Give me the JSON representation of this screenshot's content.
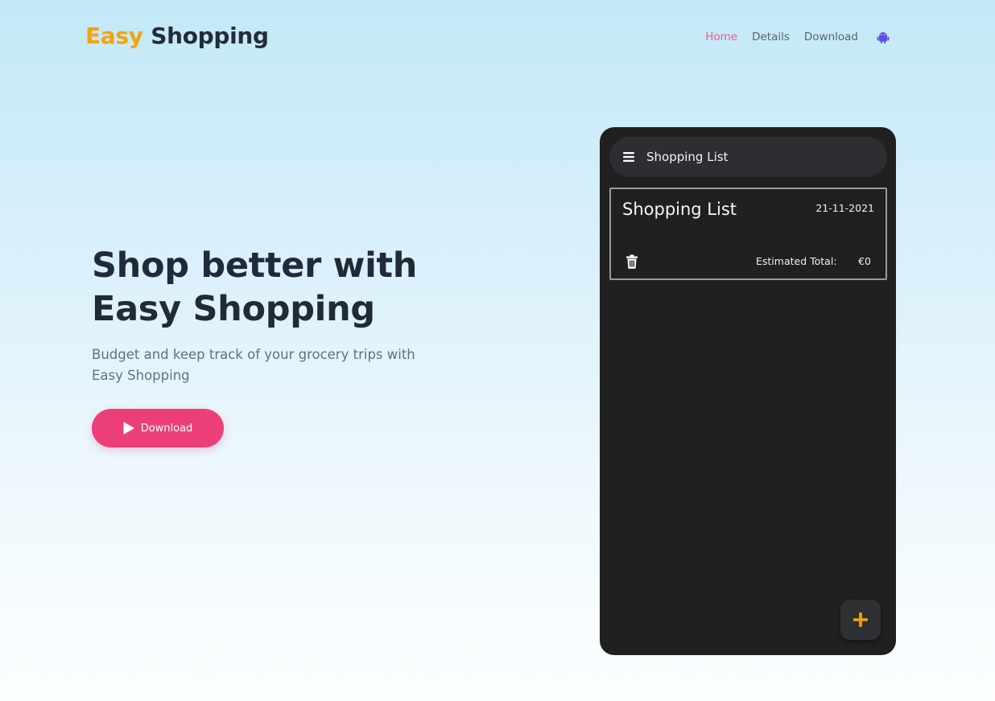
{
  "brand": {
    "part1": "Easy",
    "part2": "Shopping"
  },
  "nav": {
    "home": "Home",
    "details": "Details",
    "download": "Download",
    "android_icon": "android-icon"
  },
  "hero": {
    "title_line1": "Shop better with",
    "title_line2": "Easy Shopping",
    "subtitle": "Budget and keep track of your grocery trips with Easy Shopping",
    "cta_label": "Download",
    "cta_icon": "play-icon"
  },
  "phone": {
    "appbar_title": "Shopping List",
    "list_card": {
      "title": "Shopping List",
      "date": "21-11-2021",
      "total_label": "Estimated Total:",
      "total_value": "€0"
    },
    "fab_icon": "plus-icon"
  },
  "colors": {
    "accent_orange": "#f5a30a",
    "accent_pink": "#ec3f78",
    "nav_active": "#ee5a86",
    "android_purple": "#5b4ee0"
  }
}
